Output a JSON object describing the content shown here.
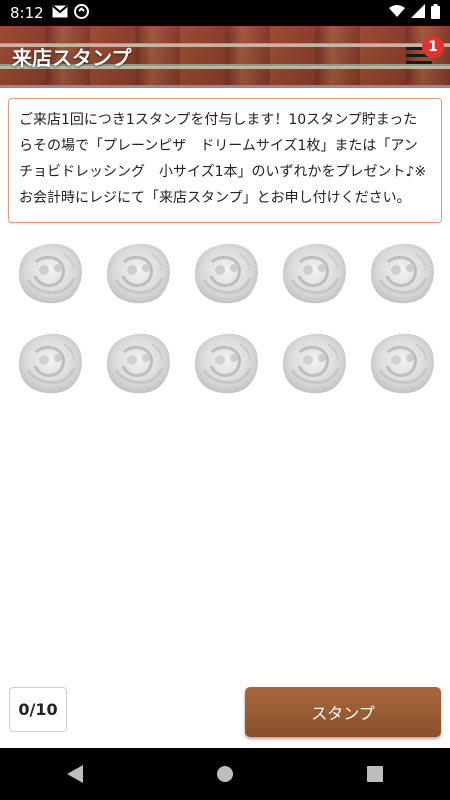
{
  "statusbar": {
    "time": "8:12"
  },
  "header": {
    "title": "来店スタンプ",
    "badge": "1"
  },
  "notice": {
    "text": "ご来店1回につき1スタンプを付与します！10スタンプ貯まったらその場で「プレーンピザ　ドリームサイズ1枚」または「アンチョビドレッシング　小サイズ1本」のいずれかをプレゼント♪※お会計時にレジにて「来店スタンプ」とお申し付けください。"
  },
  "stamps": {
    "total": 10,
    "collected": 0
  },
  "footer": {
    "counter": "0/10",
    "stamp_button": "スタンプ"
  },
  "icons": [
    "gmail-icon",
    "sync-icon",
    "wifi-icon",
    "signal-icon",
    "battery-icon",
    "menu-icon",
    "back-icon",
    "home-icon",
    "recents-icon",
    "stamp-placeholder-icon"
  ]
}
